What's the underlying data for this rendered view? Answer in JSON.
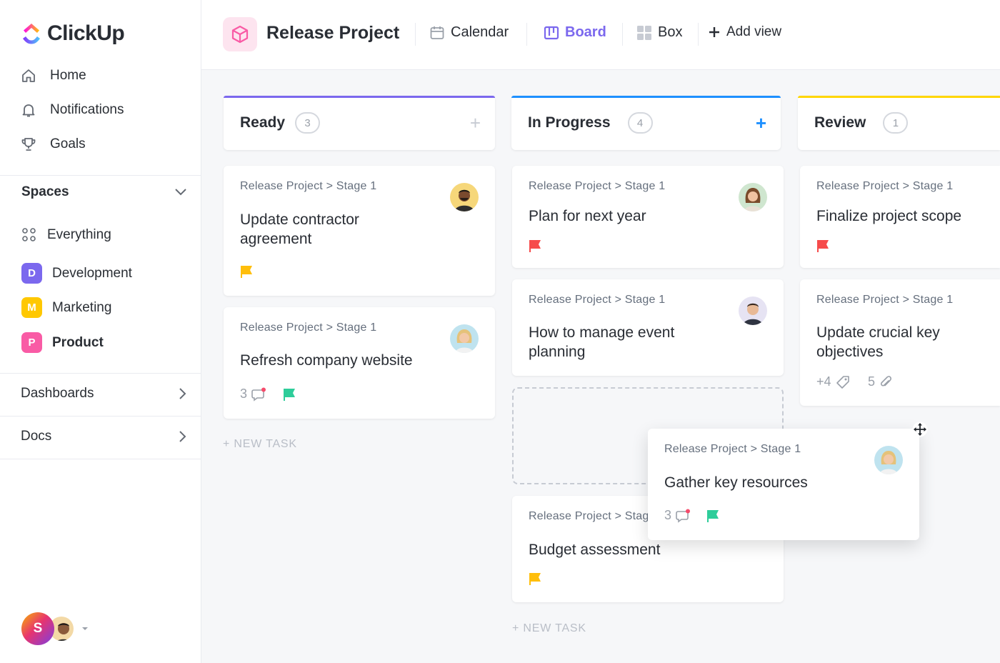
{
  "sidebar": {
    "logo_text": "ClickUp",
    "nav": [
      {
        "label": "Home",
        "icon": "home-icon"
      },
      {
        "label": "Notifications",
        "icon": "bell-icon"
      },
      {
        "label": "Goals",
        "icon": "trophy-icon"
      }
    ],
    "spaces_label": "Spaces",
    "spaces": [
      {
        "label": "Everything",
        "icon": "grid-icon"
      },
      {
        "label": "Development",
        "badge": "D",
        "color": "#7b68ee"
      },
      {
        "label": "Marketing",
        "badge": "M",
        "color": "#ffc800"
      },
      {
        "label": "Product",
        "badge": "P",
        "color": "#f95ba5",
        "selected": true
      }
    ],
    "dashboards_label": "Dashboards",
    "docs_label": "Docs",
    "user_initial": "S"
  },
  "header": {
    "project_title": "Release Project",
    "views": [
      {
        "label": "Calendar",
        "icon": "calendar-icon"
      },
      {
        "label": "Board",
        "icon": "board-icon",
        "active": true
      },
      {
        "label": "Box",
        "icon": "box-icon"
      },
      {
        "label": "Add view",
        "icon": "plus-icon"
      }
    ]
  },
  "board": {
    "columns": [
      {
        "title": "Ready",
        "count": "3",
        "color": "#7b68ee",
        "cards": [
          {
            "crumb": "Release Project > Stage 1",
            "title": "Update contractor agreement",
            "flag": "#ffbe0b"
          },
          {
            "crumb": "Release Project > Stage 1",
            "title": "Refresh company website",
            "comments": "3",
            "flag": "#2ecd9a"
          }
        ],
        "new_task": "+ NEW TASK"
      },
      {
        "title": "In Progress",
        "count": "4",
        "color": "#1e90ff",
        "cards": [
          {
            "crumb": "Release Project > Stage 1",
            "title": "Plan for next year",
            "flag": "#f64b4b"
          },
          {
            "crumb": "Release Project > Stage 1",
            "title": "How to manage event planning"
          },
          {
            "crumb": "Release Project > Stage 1",
            "title": "Budget assessment",
            "flag": "#ffbe0b"
          }
        ],
        "new_task": "+ NEW TASK"
      },
      {
        "title": "Review",
        "count": "1",
        "color": "#ffd600",
        "cards": [
          {
            "crumb": "Release Project > Stage 1",
            "title": "Finalize project scope",
            "flag": "#f64b4b"
          },
          {
            "crumb": "Release Project > Stage 1",
            "title": "Update crucial key objectives",
            "tags": "+4",
            "attachments": "5"
          }
        ]
      }
    ],
    "dragging_card": {
      "crumb": "Release Project > Stage 1",
      "title": "Gather key resources",
      "comments": "3",
      "flag": "#2ecd9a"
    }
  }
}
